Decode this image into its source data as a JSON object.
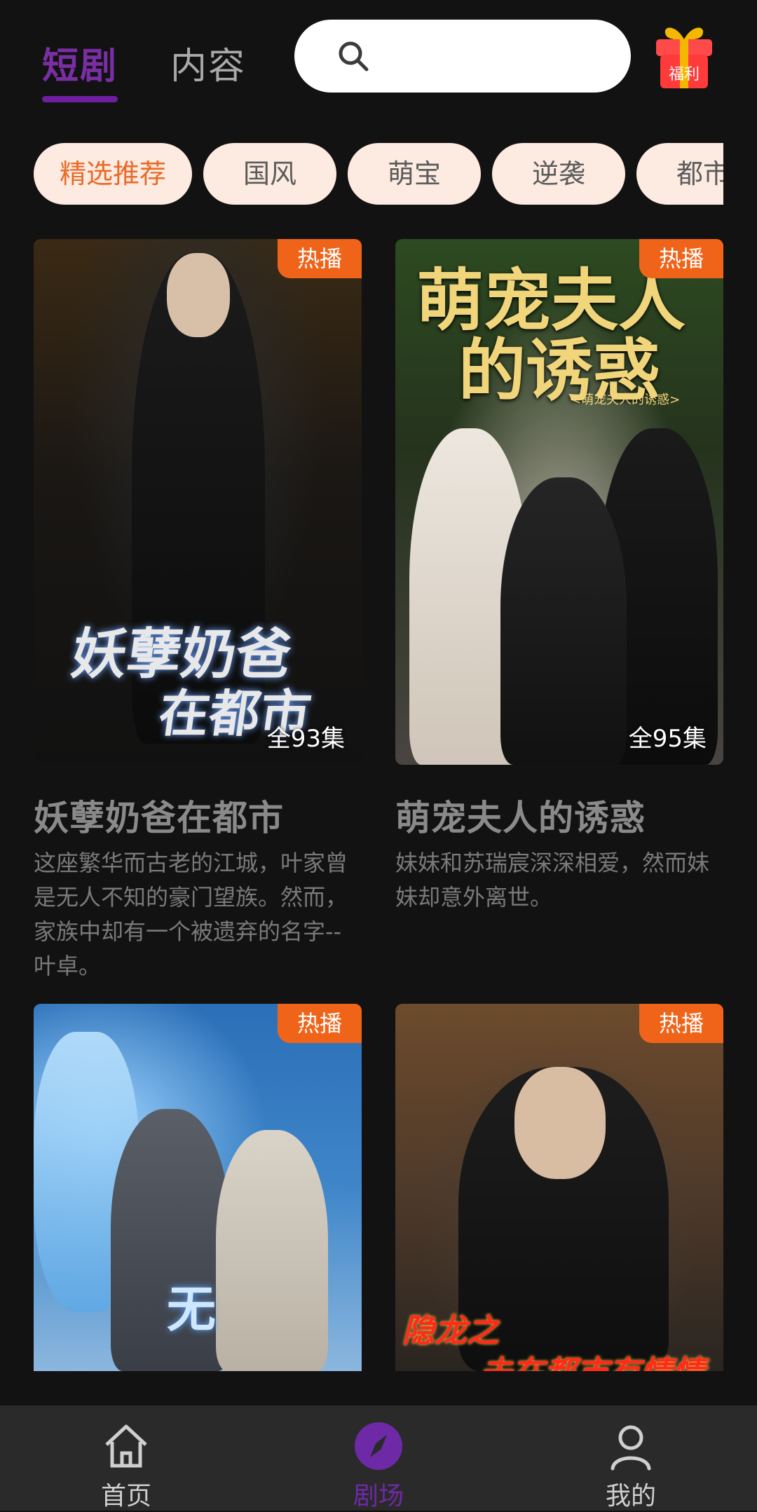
{
  "header": {
    "tabs": [
      {
        "label": "短剧",
        "active": true
      },
      {
        "label": "内容",
        "active": false
      }
    ],
    "search": {
      "icon": "search-icon"
    },
    "gift": {
      "label": "福利",
      "icon": "gift-icon"
    }
  },
  "categories": {
    "items": [
      {
        "label": "精选推荐",
        "active": true
      },
      {
        "label": "国风"
      },
      {
        "label": "萌宝"
      },
      {
        "label": "逆袭"
      },
      {
        "label": "都市"
      }
    ]
  },
  "dramas": [
    {
      "badge": "热播",
      "episodes": "全93集",
      "poster_text": [
        "妖孽奶爸",
        "在都市"
      ],
      "title": "妖孽奶爸在都市",
      "description": "这座繁华而古老的江城，叶家曾是无人不知的豪门望族。然而，家族中却有一个被遗弃的名字--叶卓。"
    },
    {
      "badge": "热播",
      "episodes": "全95集",
      "poster_text": [
        "萌宠夫人",
        "的诱惑",
        "<萌宠夫人的诱惑>"
      ],
      "title": "萌宠夫人的诱惑",
      "description": "妹妹和苏瑞宸深深相爱，然而妹妹却意外离世。"
    },
    {
      "badge": "热播",
      "poster_text": [
        "无"
      ]
    },
    {
      "badge": "热播",
      "poster_text": [
        "隐龙之",
        "未在都市有情情"
      ]
    }
  ],
  "bottom_nav": {
    "items": [
      {
        "label": "首页",
        "icon": "home-icon",
        "active": false
      },
      {
        "label": "剧场",
        "icon": "compass-icon",
        "active": true
      },
      {
        "label": "我的",
        "icon": "user-icon",
        "active": false
      }
    ]
  },
  "colors": {
    "accent_purple": "#6e1fa0",
    "badge_orange": "#f0641a",
    "chip_bg": "#fdebe1",
    "chip_active_text": "#e96a27",
    "background": "#121212"
  }
}
